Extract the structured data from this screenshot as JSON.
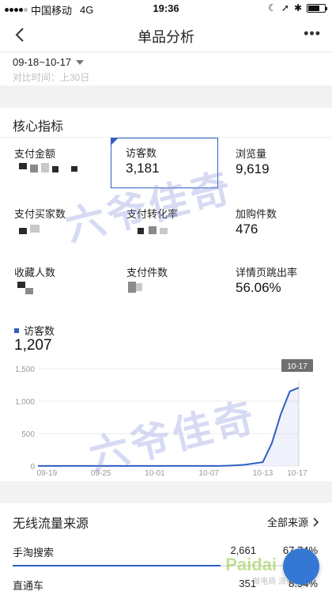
{
  "status_bar": {
    "carrier": "中国移动",
    "network": "4G",
    "time": "19:36",
    "battery_level": 0.7
  },
  "nav": {
    "title": "单品分析",
    "more": "•••"
  },
  "date": {
    "range": "09-18~10-17",
    "compare": "对比时间：上30日"
  },
  "core": {
    "title": "核心指标",
    "metrics": [
      {
        "label": "支付金额",
        "value": ""
      },
      {
        "label": "访客数",
        "value": "3,181"
      },
      {
        "label": "浏览量",
        "value": "9,619"
      },
      {
        "label": "支付买家数",
        "value": ""
      },
      {
        "label": "支付转化率",
        "value": ""
      },
      {
        "label": "加购件数",
        "value": "476"
      },
      {
        "label": "收藏人数",
        "value": ""
      },
      {
        "label": "支付件数",
        "value": ""
      },
      {
        "label": "详情页跳出率",
        "value": "56.06%"
      }
    ],
    "series_name": "访客数",
    "series_total": "1,207"
  },
  "chart_data": {
    "type": "area",
    "yticks": [
      "0",
      "500",
      "1,000",
      "1,500"
    ],
    "xticks": [
      "09-19",
      "09-25",
      "10-01",
      "10-07",
      "10-13",
      "10-17"
    ],
    "ylim": [
      0,
      1500
    ],
    "x": [
      "09-18",
      "09-19",
      "09-20",
      "09-21",
      "09-22",
      "09-23",
      "09-24",
      "09-25",
      "09-26",
      "09-27",
      "09-28",
      "09-29",
      "09-30",
      "10-01",
      "10-02",
      "10-03",
      "10-04",
      "10-05",
      "10-06",
      "10-07",
      "10-08",
      "10-09",
      "10-10",
      "10-11",
      "10-12",
      "10-13",
      "10-14",
      "10-15",
      "10-16",
      "10-17"
    ],
    "values": [
      2,
      2,
      2,
      2,
      2,
      2,
      2,
      2,
      2,
      2,
      2,
      2,
      2,
      2,
      2,
      2,
      2,
      2,
      2,
      2,
      2,
      5,
      10,
      20,
      40,
      60,
      350,
      800,
      1150,
      1207
    ],
    "tooltip": "10-17",
    "line_color": "#2f5fbf"
  },
  "sources": {
    "title": "无线流量来源",
    "all_label": "全部来源",
    "rows": [
      {
        "name": "手淘搜索",
        "count": "2,661",
        "pct": "67.74%",
        "share": 0.6774
      },
      {
        "name": "直通车",
        "count": "351",
        "pct": "8.94%",
        "share": 0.0894
      }
    ]
  },
  "watermarks": {
    "overlay": "六爷佳奇",
    "brand": "Paidai",
    "brand_sub": "做电商 派代"
  },
  "colors": {
    "accent": "#2f5fbf",
    "fab": "#3478d4"
  }
}
